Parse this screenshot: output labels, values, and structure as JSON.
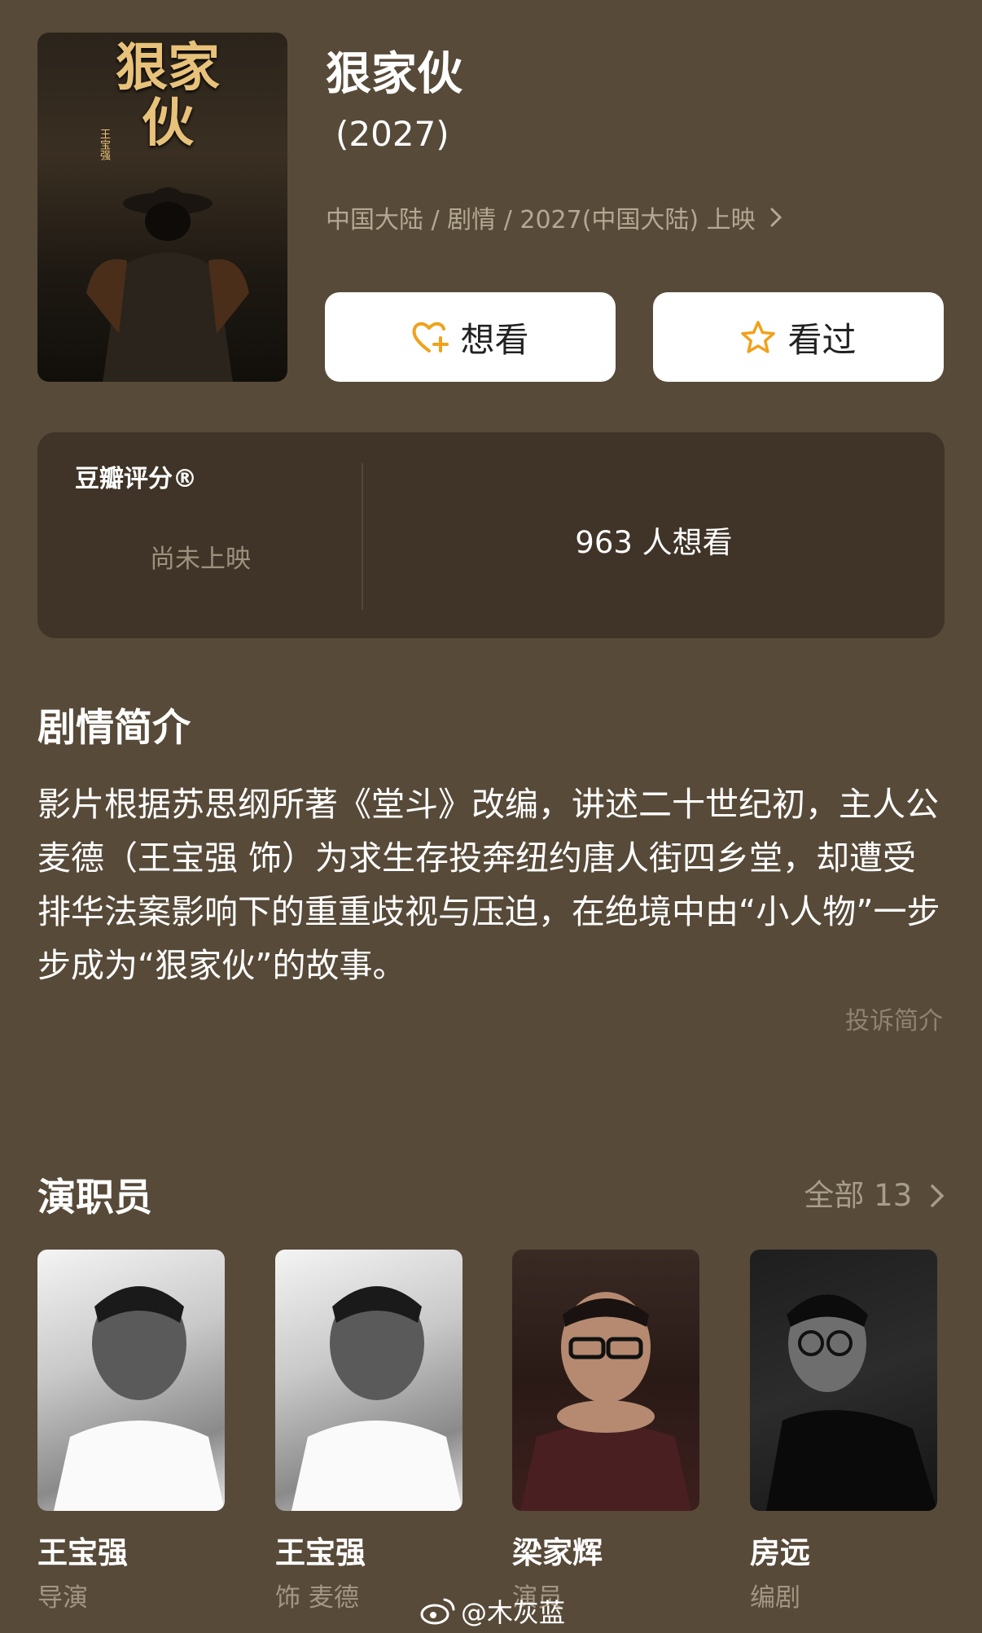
{
  "movie": {
    "title": "狠家伙",
    "year": "(2027)",
    "meta": "中国大陆 / 剧情 / 2027(中国大陆) 上映",
    "poster_title": "狠家伙",
    "poster_actor": "王宝强"
  },
  "actions": {
    "want_label": "想看",
    "seen_label": "看过"
  },
  "rating": {
    "label": "豆瓣评分®",
    "value": "尚未上映",
    "want_count": "963 人想看"
  },
  "synopsis": {
    "title": "剧情简介",
    "text": "影片根据苏思纲所著《堂斗》改编，讲述二十世纪初，主人公麦德（王宝强 饰）为求生存投奔纽约唐人街四乡堂，却遭受排华法案影响下的重重歧视与压迫，在绝境中由“小人物”一步步成为“狠家伙”的故事。",
    "report_label": "投诉简介"
  },
  "cast": {
    "title": "演职员",
    "all_label": "全部 13",
    "members": [
      {
        "name": "王宝强",
        "role": "导演"
      },
      {
        "name": "王宝强",
        "role": "饰 麦德"
      },
      {
        "name": "梁家辉",
        "role": "演员"
      },
      {
        "name": "房远",
        "role": "编剧"
      }
    ]
  },
  "watermark": "@木灰蓝",
  "colors": {
    "background": "#574a39",
    "panel": "#3f3427",
    "accent_icon": "#f0a21b"
  }
}
